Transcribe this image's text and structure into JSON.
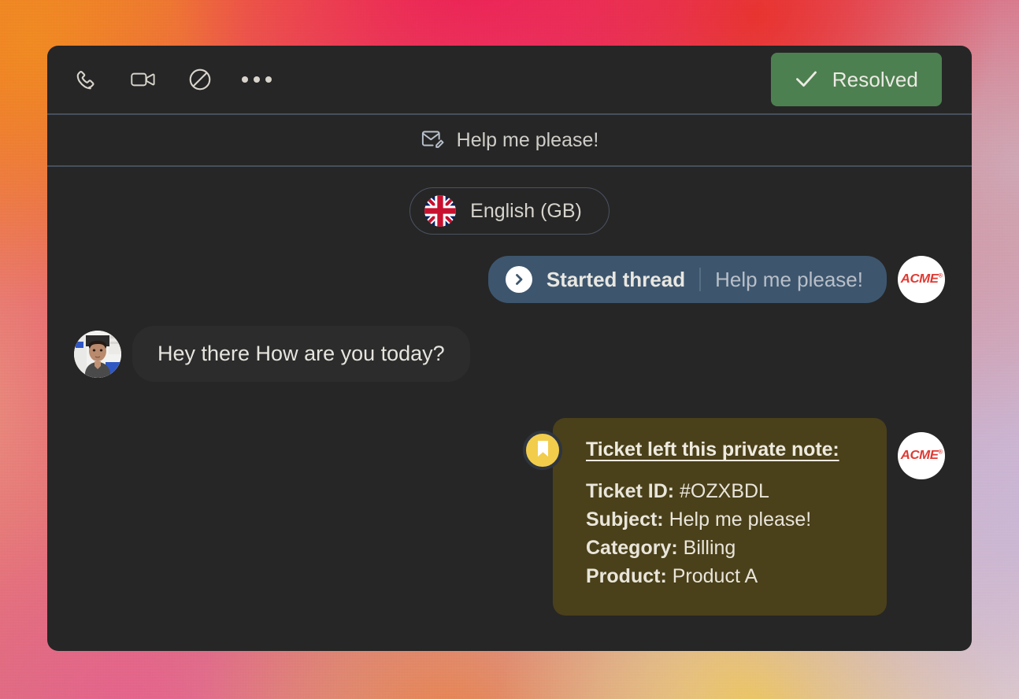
{
  "background": {
    "colors": [
      "#ef7a2a",
      "#e8456a",
      "#ec1c57",
      "#e8342f",
      "#d3aec0",
      "#c9b6d6",
      "#ecc563",
      "#e6628c"
    ]
  },
  "panel": {
    "background_color": "#262626",
    "divider_color": "#474f5d"
  },
  "action_bar": {
    "icons": [
      {
        "name": "phone-icon",
        "label": "Call"
      },
      {
        "name": "video-camera-icon",
        "label": "Video call"
      },
      {
        "name": "block-icon",
        "label": "Block"
      },
      {
        "name": "more-options-icon",
        "label": "More options"
      }
    ],
    "resolved_button": {
      "label": "Resolved",
      "icon": "check-icon",
      "color": "#4d8050"
    }
  },
  "subject_bar": {
    "icon": "mail-edit-icon",
    "text": "Help me please!"
  },
  "language_pill": {
    "flag": "flag-gb-icon",
    "label": "English (GB)"
  },
  "thread_message": {
    "icon": "chevron-right-circle-icon",
    "title": "Started thread",
    "subject": "Help me please!",
    "avatar": "acme-avatar",
    "avatar_label": "ACME",
    "bubble_color": "#3d566e"
  },
  "incoming_message": {
    "text": "Hey there How are you today?",
    "avatar": "agent-photo-avatar",
    "bubble_color": "#2c2c2c"
  },
  "private_note": {
    "badge_icon": "bookmark-icon",
    "badge_color": "#f2cd4c",
    "title": "Ticket left this private note:",
    "bubble_color": "#4a401a",
    "fields": [
      {
        "label": "Ticket ID:",
        "value": "#OZXBDL"
      },
      {
        "label": "Subject:",
        "value": "Help me please!"
      },
      {
        "label": "Category:",
        "value": "Billing"
      },
      {
        "label": "Product:",
        "value": "Product A"
      }
    ],
    "avatar": "acme-avatar",
    "avatar_label": "ACME"
  }
}
